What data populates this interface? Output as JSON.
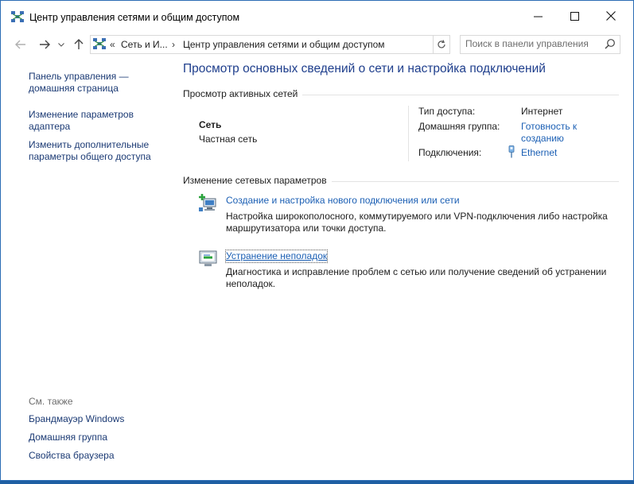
{
  "window": {
    "title": "Центр управления сетями и общим доступом",
    "minimize": "—",
    "maximize": "☐",
    "close": "✕"
  },
  "nav": {
    "back": "←",
    "forward": "→",
    "recent": "⌄",
    "up": "↑",
    "breadcrumb_lead": "«",
    "breadcrumb": [
      "Сеть и И...",
      "Центр управления сетями и общим доступом"
    ],
    "breadcrumb_sep": "›",
    "dropdown": "⌄",
    "refresh": "↻",
    "search_placeholder": "Поиск в панели управления"
  },
  "sidebar": {
    "home_line1": "Панель управления —",
    "home_line2": "домашняя страница",
    "adapter_line1": "Изменение параметров",
    "adapter_line2": "адаптера",
    "sharing_line1": "Изменить дополнительные",
    "sharing_line2": "параметры общего доступа",
    "see_also": "См. также",
    "see_also_links": [
      "Брандмауэр Windows",
      "Домашняя группа",
      "Свойства браузера"
    ]
  },
  "main": {
    "heading": "Просмотр основных сведений о сети и настройка подключений",
    "active_section": "Просмотр активных сетей",
    "network_name": "Сеть",
    "network_type": "Частная сеть",
    "access_type_label": "Тип доступа:",
    "access_type_value": "Интернет",
    "homegroup_label": "Домашняя группа:",
    "homegroup_line1": "Готовность к",
    "homegroup_line2": "созданию",
    "connections_label": "Подключения:",
    "connections_value": "Ethernet",
    "change_section": "Изменение сетевых параметров",
    "task1_title": "Создание и настройка нового подключения или сети",
    "task1_desc": "Настройка широкополосного, коммутируемого или VPN-подключения либо настройка маршрутизатора или точки доступа.",
    "task2_title": "Устранение неполадок",
    "task2_desc": "Диагностика и исправление проблем с сетью или получение сведений об устранении неполадок."
  },
  "colors": {
    "link": "#1b5fb4",
    "heading": "#1e3e8c",
    "desktop": "#1f5fa3"
  }
}
